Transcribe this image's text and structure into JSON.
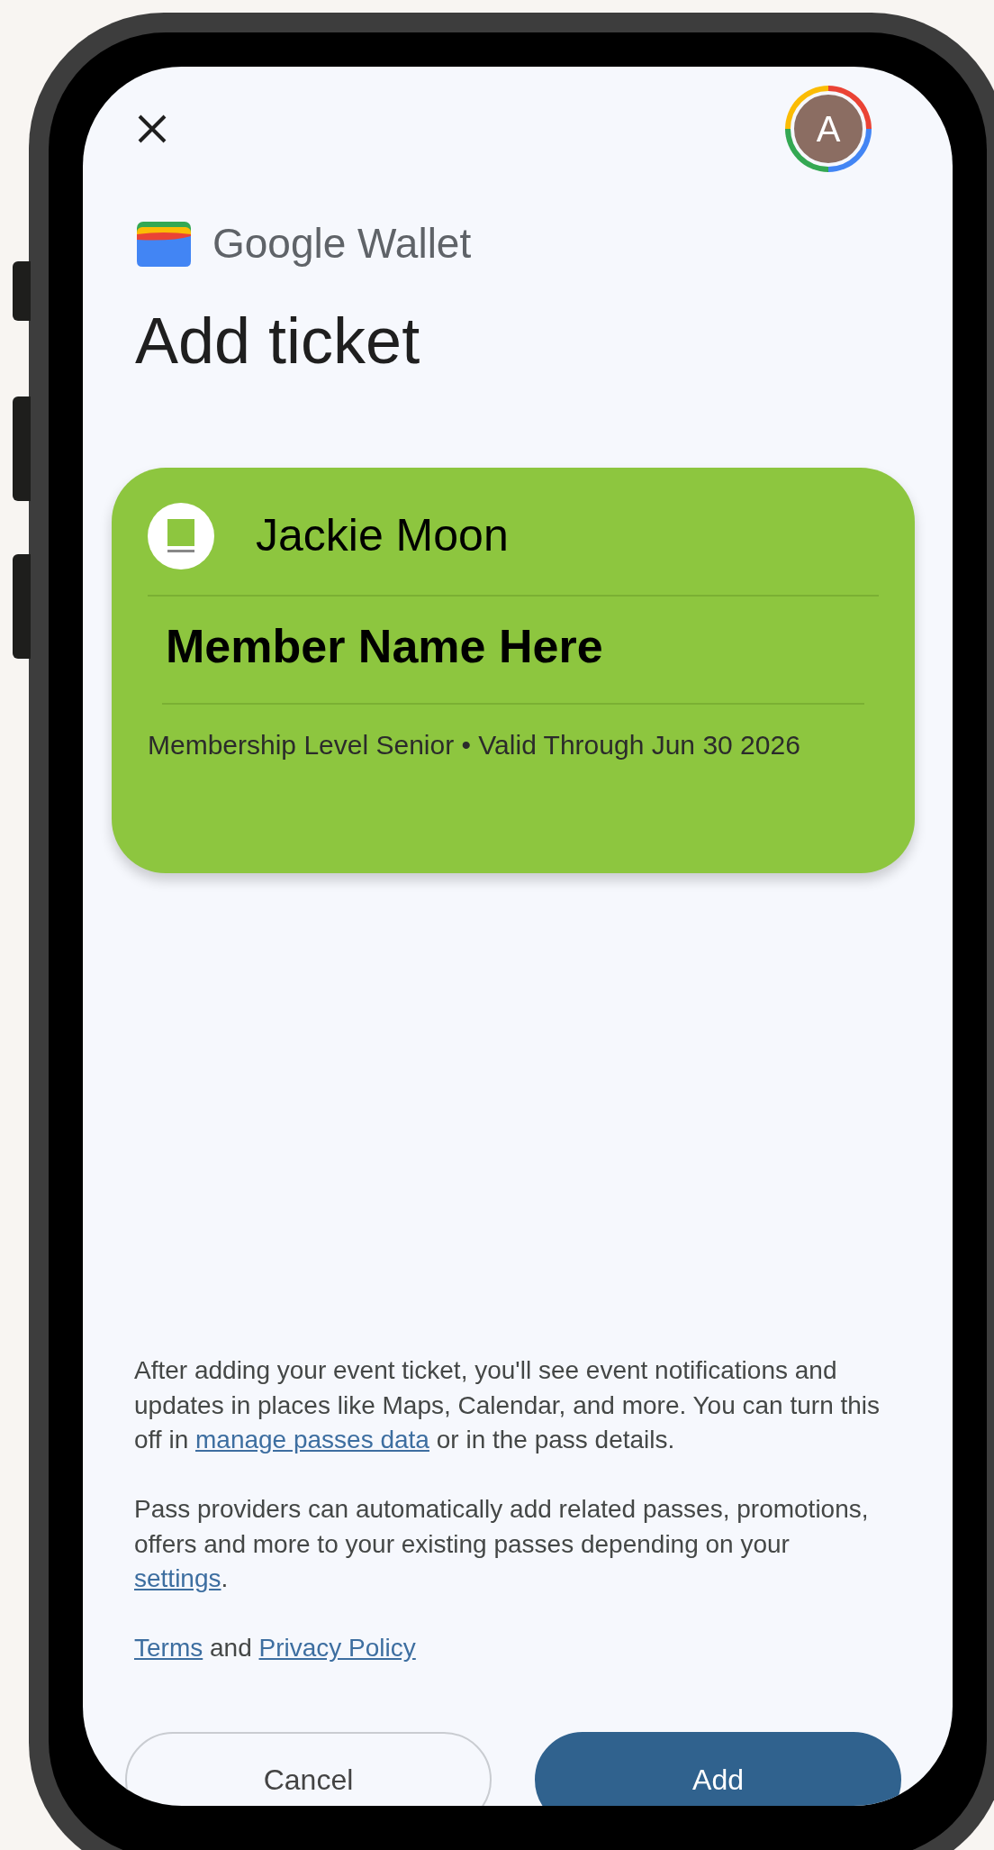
{
  "avatar": {
    "initial": "A"
  },
  "brand": {
    "name": "Google Wallet"
  },
  "title": "Add ticket",
  "pass": {
    "issuer": "Jackie Moon",
    "member_name": "Member Name Here",
    "details": "Membership Level Senior • Valid Through Jun 30 2026"
  },
  "notices": [
    {
      "parts": [
        {
          "kind": "text",
          "text": "After adding your event ticket, you'll see event notifications and updates in places like Maps, Calendar, and more. You can turn this off in "
        },
        {
          "kind": "link",
          "text": "manage passes data"
        },
        {
          "kind": "text",
          "text": " or in the pass details."
        }
      ]
    },
    {
      "parts": [
        {
          "kind": "text",
          "text": "Pass providers can automatically add related passes, promotions, offers and more to your existing passes depending on your "
        },
        {
          "kind": "link",
          "text": "settings"
        },
        {
          "kind": "text",
          "text": "."
        }
      ]
    },
    {
      "parts": [
        {
          "kind": "link",
          "text": "Terms"
        },
        {
          "kind": "text",
          "text": " and "
        },
        {
          "kind": "link",
          "text": "Privacy Policy"
        }
      ]
    }
  ],
  "buttons": [
    {
      "label": "Cancel",
      "kind": "outlined"
    },
    {
      "label": "Add",
      "kind": "filled"
    }
  ]
}
